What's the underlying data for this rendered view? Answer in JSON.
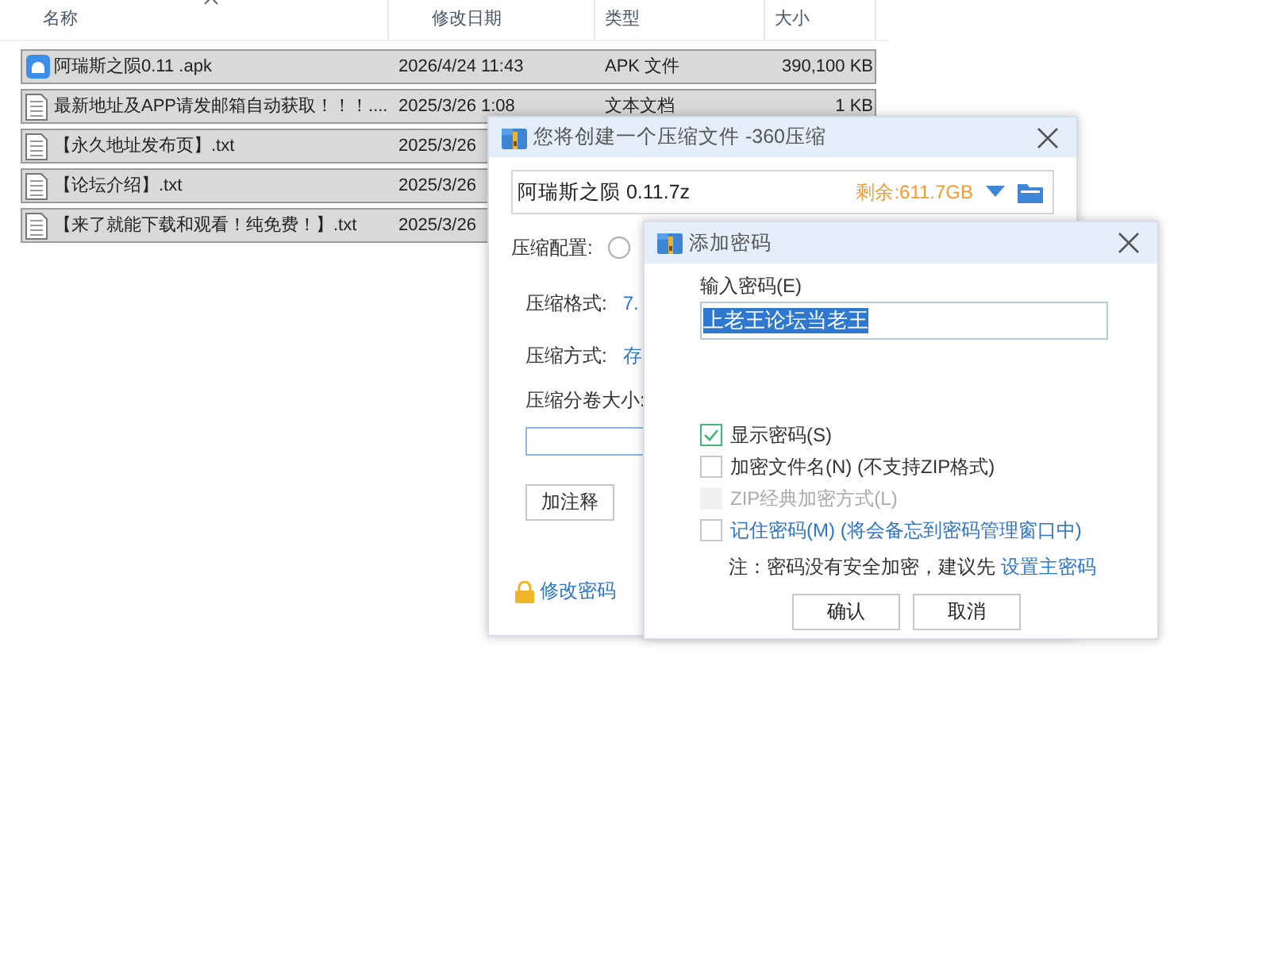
{
  "file_list": {
    "columns": [
      {
        "label": "名称",
        "sorted": true
      },
      {
        "label": "修改日期",
        "sorted": false
      },
      {
        "label": "类型",
        "sorted": false
      },
      {
        "label": "大小",
        "sorted": false
      }
    ],
    "rows": [
      {
        "kind": "apk",
        "name": "阿瑞斯之陨0.11 .apk",
        "date": "2026/4/24 11:43",
        "type": "APK 文件",
        "size": "390,100 KB",
        "selected": true
      },
      {
        "kind": "text",
        "name": "最新地址及APP请发邮箱自动获取！！！....",
        "date": "2025/3/26 1:08",
        "type": "文本文档",
        "size": "1 KB",
        "selected": true
      },
      {
        "kind": "text",
        "name": "【永久地址发布页】.txt",
        "date": "2025/3/26",
        "selected": true
      },
      {
        "kind": "text",
        "name": "【论坛介绍】.txt",
        "date": "2025/3/26",
        "selected": true
      },
      {
        "kind": "text",
        "name": "【来了就能下载和观看！纯免费！】.txt",
        "date": "2025/3/26",
        "selected": true
      }
    ]
  },
  "create_dialog": {
    "title": "您将创建一个压缩文件 -360压缩",
    "file_name": "阿瑞斯之陨 0.11.7z",
    "free_space": "剩余:611.7GB",
    "config_label": "压缩配置:",
    "config_radio_checked": false,
    "settings": [
      {
        "label": "压缩格式:",
        "value": "7."
      },
      {
        "label": "压缩方式:",
        "value": "存"
      }
    ],
    "split_label": "压缩分卷大小:",
    "comment_button": "加注释",
    "password_link": "修改密码"
  },
  "password_dialog": {
    "title": "添加密码",
    "input_label": "输入密码(E)",
    "password": "上老王论坛当老王",
    "options": [
      {
        "kind": "plain",
        "label": "显示密码(S)",
        "checked": true,
        "disabled": false
      },
      {
        "kind": "plain",
        "label": "加密文件名(N) (不支持ZIP格式)",
        "checked": false,
        "disabled": false
      },
      {
        "kind": "plain",
        "label": "ZIP经典加密方式(L)",
        "checked": false,
        "disabled": true
      },
      {
        "kind": "link",
        "label": "记住密码(M) (将会备忘到密码管理窗口中)",
        "checked": false,
        "disabled": false
      }
    ],
    "note": "注：密码没有安全加密，建议先",
    "note_link": "设置主密码",
    "buttons": [
      "确认",
      "取消"
    ]
  }
}
